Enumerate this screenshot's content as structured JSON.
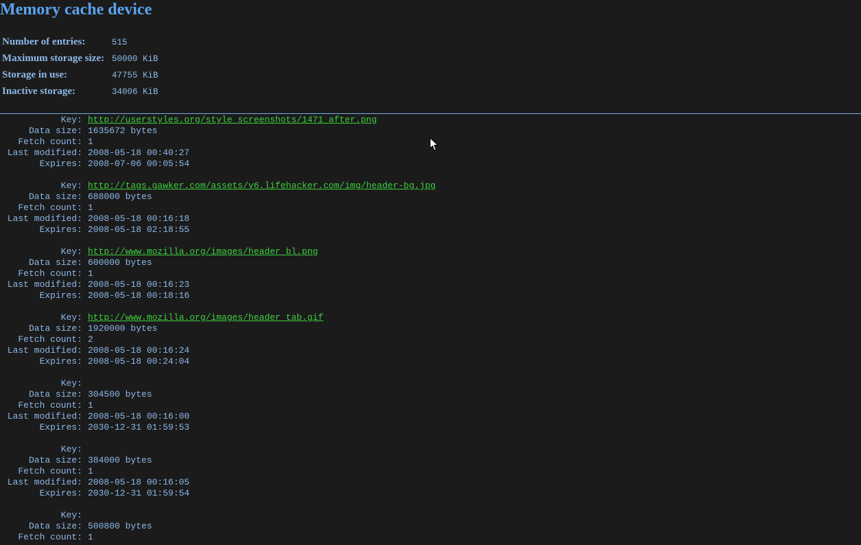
{
  "title": "Memory cache device",
  "summary": [
    {
      "label": "Number of entries:",
      "value": "515"
    },
    {
      "label": "Maximum storage size:",
      "value": "50000 KiB"
    },
    {
      "label": "Storage in use:",
      "value": "47755 KiB"
    },
    {
      "label": "Inactive storage:",
      "value": "34006 KiB"
    }
  ],
  "field_labels": {
    "key": "Key:",
    "data_size": "Data size:",
    "fetch_count": "Fetch count:",
    "last_modified": "Last modified:",
    "expires": "Expires:"
  },
  "entries": [
    {
      "key": "http://userstyles.org/style_screenshots/1471_after.png",
      "data_size": "1635672 bytes",
      "fetch_count": "1",
      "last_modified": "2008-05-18 00:40:27",
      "expires": "2008-07-06 00:05:54"
    },
    {
      "key": "http://tags.gawker.com/assets/v6.lifehacker.com/img/header-bg.jpg",
      "data_size": "688000 bytes",
      "fetch_count": "1",
      "last_modified": "2008-05-18 00:16:18",
      "expires": "2008-05-18 02:18:55"
    },
    {
      "key": "http://www.mozilla.org/images/header_bl.png",
      "data_size": "600000 bytes",
      "fetch_count": "1",
      "last_modified": "2008-05-18 00:16:23",
      "expires": "2008-05-18 00:18:16"
    },
    {
      "key": "http://www.mozilla.org/images/header_tab.gif",
      "data_size": "1920000 bytes",
      "fetch_count": "2",
      "last_modified": "2008-05-18 00:16:24",
      "expires": "2008-05-18 00:24:04"
    },
    {
      "key": "",
      "data_size": "304500 bytes",
      "fetch_count": "1",
      "last_modified": "2008-05-18 00:16:00",
      "expires": "2030-12-31 01:59:53"
    },
    {
      "key": "",
      "data_size": "384000 bytes",
      "fetch_count": "1",
      "last_modified": "2008-05-18 00:16:05",
      "expires": "2030-12-31 01:59:54"
    },
    {
      "key": "",
      "data_size": "500800 bytes",
      "fetch_count": "1",
      "last_modified": "",
      "expires": ""
    }
  ],
  "colors": {
    "background": "#1b1b1b",
    "title": "#5aa3f0",
    "text": "#8cb8e8",
    "link": "#3cd13c",
    "divider": "#78aee8"
  },
  "icons": {
    "cursor": "mouse-pointer-icon"
  }
}
